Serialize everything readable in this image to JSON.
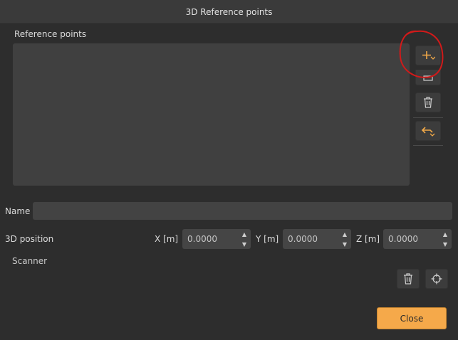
{
  "window": {
    "title": "3D Reference points"
  },
  "reference_points": {
    "label": "Reference points",
    "items": []
  },
  "toolbar": {
    "buttons": [
      {
        "name": "add-point-button",
        "icon": "add-point-icon"
      },
      {
        "name": "rename-point-button",
        "icon": "rename-icon"
      },
      {
        "name": "delete-point-button",
        "icon": "trash-icon"
      },
      {
        "name": "import-points-button",
        "icon": "import-icon"
      }
    ]
  },
  "name": {
    "label": "Name",
    "value": ""
  },
  "position": {
    "label": "3D position",
    "x": {
      "label": "X [m]",
      "value": "0.0000"
    },
    "y": {
      "label": "Y [m]",
      "value": "0.0000"
    },
    "z": {
      "label": "Z [m]",
      "value": "0.0000"
    }
  },
  "scanner": {
    "label": "Scanner"
  },
  "scanner_buttons": [
    {
      "name": "scanner-delete-button",
      "icon": "trash-icon"
    },
    {
      "name": "scanner-target-button",
      "icon": "crosshair-icon"
    }
  ],
  "footer": {
    "close_label": "Close"
  },
  "colors": {
    "accent": "#f5a94a",
    "background": "#2d2d2d",
    "annotation": "#d11a1a"
  }
}
